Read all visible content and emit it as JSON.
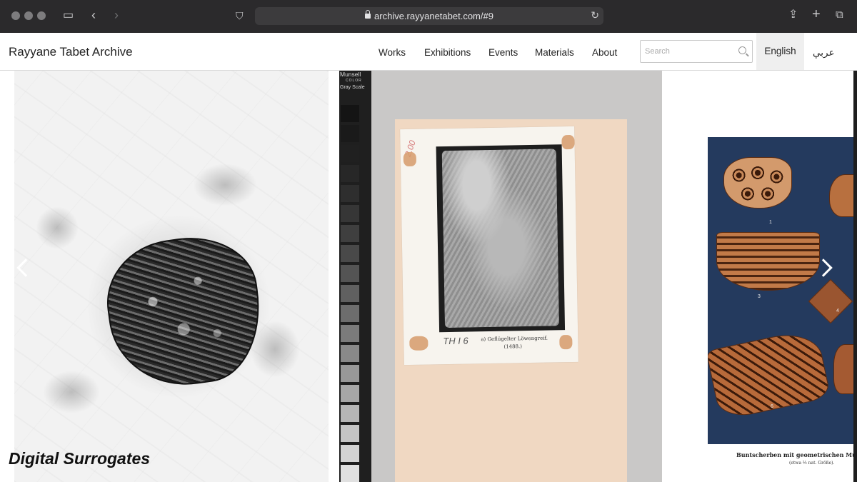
{
  "browser": {
    "url": "archive.rayyanetabet.com/#9"
  },
  "site": {
    "title": "Rayyane Tabet Archive",
    "nav": [
      "Works",
      "Exhibitions",
      "Events",
      "Materials",
      "About"
    ],
    "search_placeholder": "Search",
    "lang_english": "English",
    "lang_arabic": "عربي"
  },
  "carousel": {
    "caption": "Digital Surrogates",
    "scale_title_1": "Munsell",
    "scale_title_2": "COLOR",
    "scale_title_3": "Gray Scale",
    "card_annotation": "2.00",
    "card_pencil": "TH I 6",
    "card_caption": "a) Geflügelter Löwengreif.",
    "card_caption_sub": "(1488.)",
    "plate_numbers": [
      "1",
      "3",
      "4",
      "6"
    ],
    "plate_caption": "Buntscherben mit geometrischen Mustern i",
    "plate_caption_sub": "(etwa ⅔ nat. Größe)."
  },
  "colors": {
    "chrome_bg": "#2b2a2c",
    "plate_bg": "#243a5e",
    "board_bg": "#f0d8c2"
  }
}
